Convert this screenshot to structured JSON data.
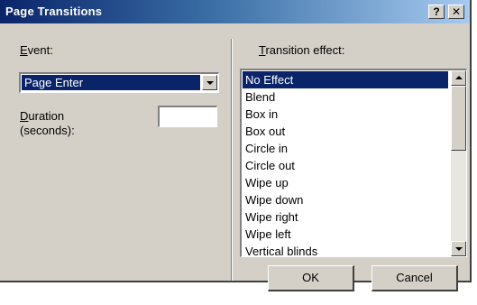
{
  "window": {
    "title": "Page Transitions",
    "help_button": "?",
    "close_button": "✕"
  },
  "event": {
    "label": "Event:",
    "selected_value": "Page Enter"
  },
  "duration": {
    "label_line1": "Duration",
    "label_line2": "(seconds):",
    "value": ""
  },
  "transition": {
    "label": "Transition effect:",
    "items": [
      "No Effect",
      "Blend",
      "Box in",
      "Box out",
      "Circle in",
      "Circle out",
      "Wipe up",
      "Wipe down",
      "Wipe right",
      "Wipe left",
      "Vertical blinds"
    ],
    "selected_index": 0
  },
  "buttons": {
    "ok": "OK",
    "cancel": "Cancel"
  },
  "colors": {
    "selection": "#0a246a",
    "dialog_face": "#d4d0c8"
  }
}
